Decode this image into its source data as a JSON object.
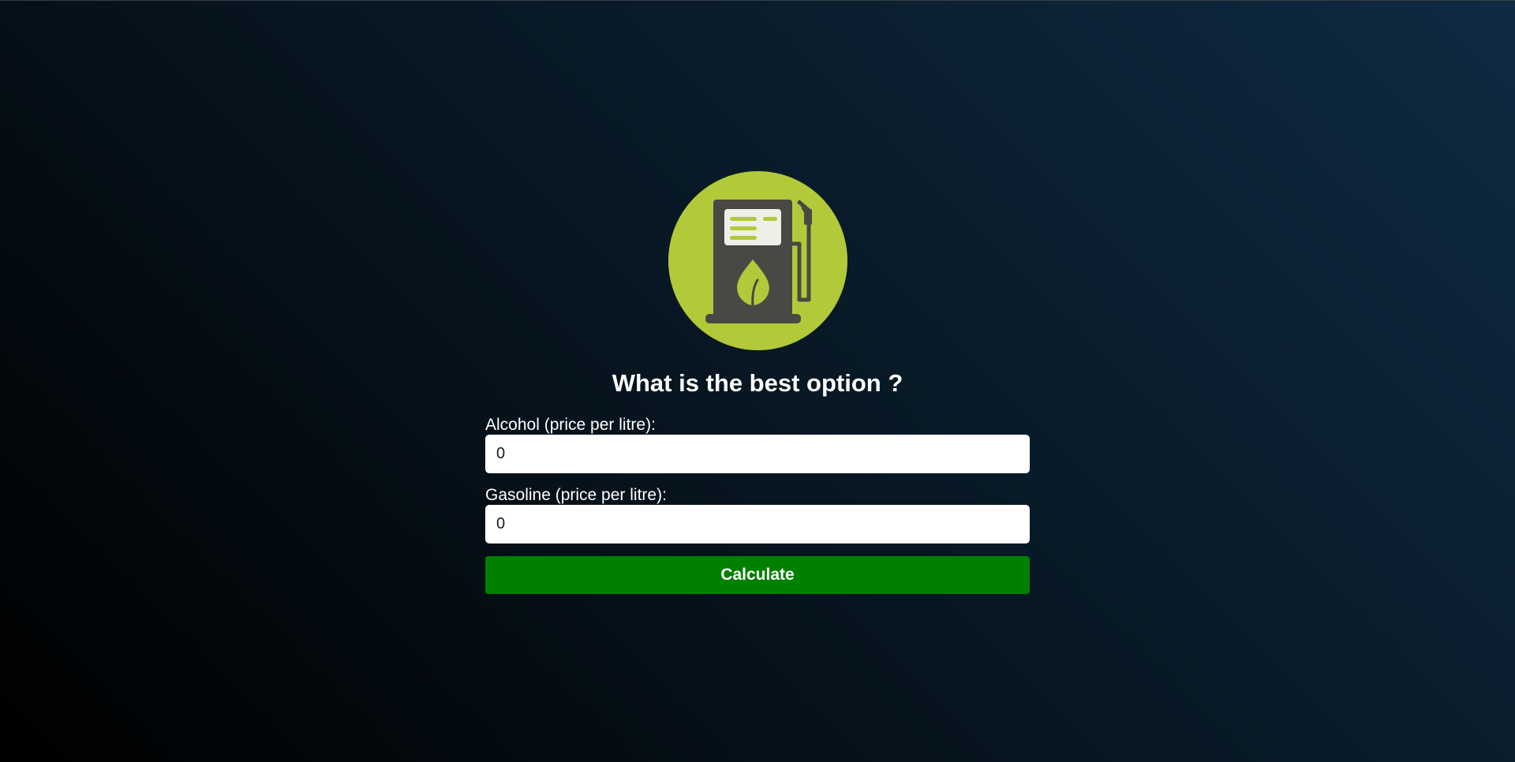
{
  "header": {
    "title": "What is the best option ?",
    "logo_icon": "fuel-pump-icon"
  },
  "colors": {
    "accent_green": "#008000",
    "logo_circle": "#b2c93a",
    "pump_body": "#4a4845",
    "background_dark": "#000000",
    "background_light": "#0f2a42"
  },
  "form": {
    "alcohol": {
      "label": "Alcohol (price per litre):",
      "value": "0"
    },
    "gasoline": {
      "label": "Gasoline (price per litre):",
      "value": "0"
    },
    "calculate_label": "Calculate"
  }
}
